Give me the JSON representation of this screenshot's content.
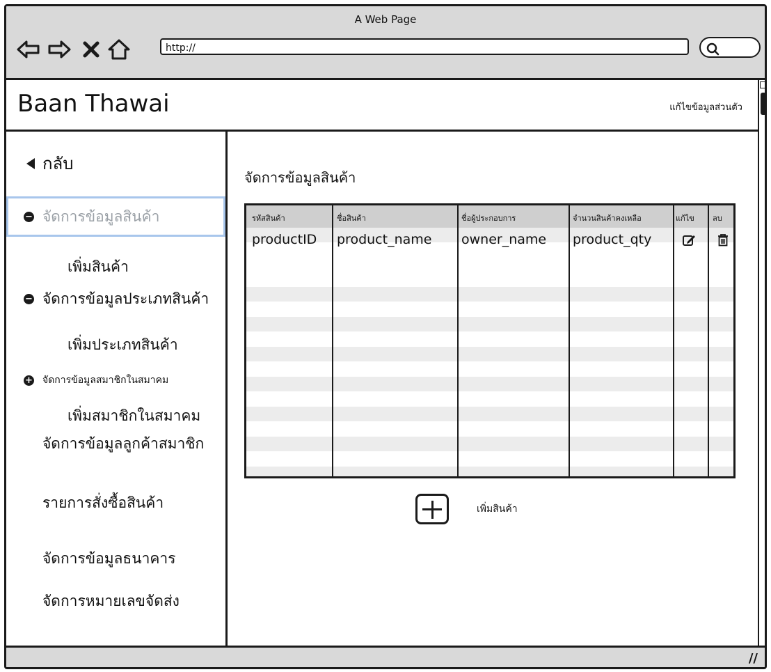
{
  "window": {
    "title": "A Web Page",
    "url": "http://"
  },
  "header": {
    "brand": "Baan Thawai",
    "profile_link": "แก้ไขข้อมูลส่วนตัว"
  },
  "sidebar": {
    "back_label": "กลับ",
    "items": [
      {
        "label": "จัดการข้อมูลสินค้า",
        "bullet": "minus",
        "active": true
      },
      {
        "label": "เพิ่มสินค้า"
      },
      {
        "label": "จัดการข้อมูลประเภทสินค้า",
        "bullet": "minus"
      },
      {
        "label": "เพิ่มประเภทสินค้า"
      },
      {
        "label": "จัดการข้อมูลสมาชิกในสมาคม",
        "bullet": "plus"
      },
      {
        "label": "เพิ่มสมาชิกในสมาคม"
      },
      {
        "label": "จัดการข้อมูลลูกค้าสมาชิก"
      },
      {
        "label": "รายการสั่งซื้อสินค้า"
      },
      {
        "label": "จัดการข้อมูลธนาคาร"
      },
      {
        "label": "จัดการหมายเลขจัดส่ง"
      }
    ]
  },
  "main": {
    "title": "จัดการข้อมูลสินค้า",
    "table": {
      "columns": [
        "รหัสสินค้า",
        "ชื่อสินค้า",
        "ชื่อผู้ประกอบการ",
        "จำนวนสินค้าคงเหลือ",
        "แก้ไข",
        "ลบ"
      ],
      "rows": [
        [
          "productID",
          "product_name",
          "owner_name",
          "product_qty",
          "edit-icon",
          "trash-icon"
        ]
      ]
    },
    "add_button_label": "เพิ่มสินค้า"
  }
}
